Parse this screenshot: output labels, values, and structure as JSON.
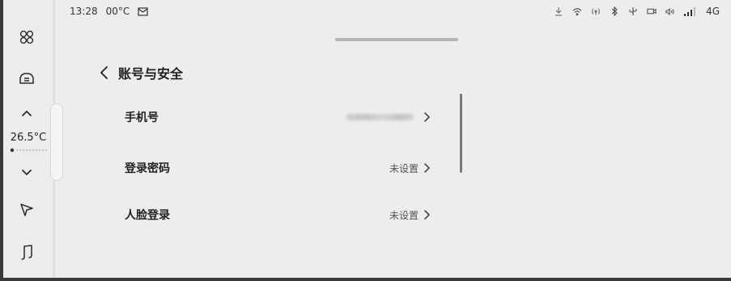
{
  "status_bar": {
    "time": "13:28",
    "temperature": "00°C",
    "message_icon": "envelope-icon",
    "network": "4G",
    "icons": [
      "download-icon",
      "wifi-icon",
      "hotspot-icon",
      "bluetooth-icon",
      "usb-icon",
      "camera-icon",
      "volume-icon",
      "signal-icon"
    ]
  },
  "sidebar": {
    "temperature": "26.5°C",
    "items": [
      {
        "icon": "apps-icon"
      },
      {
        "icon": "car-icon"
      },
      {
        "icon": "chevron-up-icon"
      },
      {
        "icon": "chevron-down-icon"
      },
      {
        "icon": "navigation-icon"
      },
      {
        "icon": "music-icon"
      }
    ]
  },
  "page": {
    "title": "账号与安全"
  },
  "rows": [
    {
      "label": "手机号",
      "value": "",
      "value_blurred": true
    },
    {
      "label": "登录密码",
      "value": "未设置",
      "value_blurred": false
    },
    {
      "label": "人脸登录",
      "value": "未设置",
      "value_blurred": false
    }
  ],
  "colors": {
    "background": "#ededed",
    "rail": "#ececec",
    "text": "#1e1e1e",
    "muted": "#555555",
    "scrollbar": "#7a7a7a"
  }
}
